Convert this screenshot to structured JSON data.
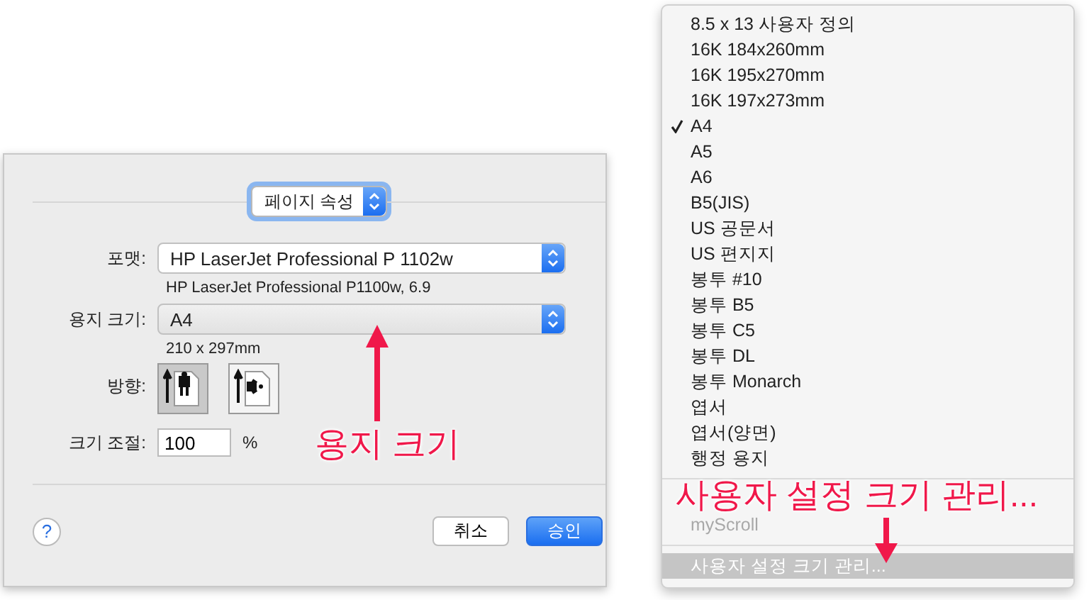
{
  "dialog": {
    "panel_popup": {
      "label": "페이지 속성"
    },
    "format": {
      "label": "포맷:",
      "value": "HP LaserJet Professional P 1102w",
      "open": false,
      "detail": "HP LaserJet Professional P1100w, 6.9"
    },
    "paper_size": {
      "label": "용지 크기:",
      "value": "A4",
      "open": true,
      "detail": "210 x 297mm"
    },
    "orientation": {
      "label": "방향:",
      "options": [
        {
          "kind": "portrait",
          "selected": true
        },
        {
          "kind": "landscape",
          "selected": false
        }
      ]
    },
    "scale": {
      "label": "크기 조절:",
      "value": "100",
      "unit": "%"
    },
    "help": "?",
    "buttons": [
      {
        "label": "취소",
        "default": false
      },
      {
        "label": "승인",
        "default": true
      }
    ]
  },
  "paper_menu": {
    "items": [
      {
        "kind": "item",
        "label": "8.5 x 13 사용자 정의",
        "checked": false,
        "disabled": false,
        "selected": false
      },
      {
        "kind": "item",
        "label": "16K 184x260mm",
        "checked": false,
        "disabled": false,
        "selected": false
      },
      {
        "kind": "item",
        "label": "16K 195x270mm",
        "checked": false,
        "disabled": false,
        "selected": false
      },
      {
        "kind": "item",
        "label": "16K 197x273mm",
        "checked": false,
        "disabled": false,
        "selected": false
      },
      {
        "kind": "item",
        "label": "A4",
        "checked": true,
        "disabled": false,
        "selected": false
      },
      {
        "kind": "item",
        "label": "A5",
        "checked": false,
        "disabled": false,
        "selected": false
      },
      {
        "kind": "item",
        "label": "A6",
        "checked": false,
        "disabled": false,
        "selected": false
      },
      {
        "kind": "item",
        "label": "B5(JIS)",
        "checked": false,
        "disabled": false,
        "selected": false
      },
      {
        "kind": "item",
        "label": "US 공문서",
        "checked": false,
        "disabled": false,
        "selected": false
      },
      {
        "kind": "item",
        "label": "US 편지지",
        "checked": false,
        "disabled": false,
        "selected": false
      },
      {
        "kind": "item",
        "label": "봉투 #10",
        "checked": false,
        "disabled": false,
        "selected": false
      },
      {
        "kind": "item",
        "label": "봉투 B5",
        "checked": false,
        "disabled": false,
        "selected": false
      },
      {
        "kind": "item",
        "label": "봉투 C5",
        "checked": false,
        "disabled": false,
        "selected": false
      },
      {
        "kind": "item",
        "label": "봉투 DL",
        "checked": false,
        "disabled": false,
        "selected": false
      },
      {
        "kind": "item",
        "label": "봉투 Monarch",
        "checked": false,
        "disabled": false,
        "selected": false
      },
      {
        "kind": "item",
        "label": "엽서",
        "checked": false,
        "disabled": false,
        "selected": false
      },
      {
        "kind": "item",
        "label": "엽서(양면)",
        "checked": false,
        "disabled": false,
        "selected": false
      },
      {
        "kind": "item",
        "label": "행정 용지",
        "checked": false,
        "disabled": false,
        "selected": false
      },
      {
        "kind": "separator"
      },
      {
        "kind": "covered"
      },
      {
        "kind": "item",
        "label": "myScroll",
        "checked": false,
        "disabled": true,
        "selected": false
      },
      {
        "kind": "separator"
      },
      {
        "kind": "item",
        "label": "사용자 설정 크기 관리...",
        "checked": false,
        "disabled": false,
        "selected": true
      }
    ]
  },
  "annotations": [
    {
      "text": "용지 크기",
      "kind": "up"
    },
    {
      "text": "사용자 설정 크기 관리...",
      "kind": "down"
    }
  ]
}
